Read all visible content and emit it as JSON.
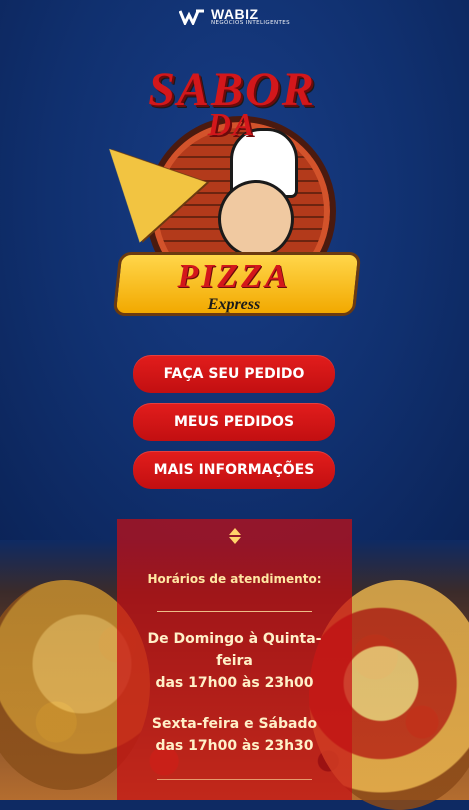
{
  "brand": {
    "name": "WABIZ",
    "tagline": "NEGÓCIOS INTELIGENTES",
    "icon": "wabiz-logo-icon"
  },
  "logo": {
    "line1": "SABOR",
    "line2": "DA",
    "ribbon_main": "PIZZA",
    "ribbon_sub": "Express"
  },
  "actions": [
    {
      "label": "FAÇA SEU PEDIDO"
    },
    {
      "label": "MEUS PEDIDOS"
    },
    {
      "label": "MAIS INFORMAÇÕES"
    }
  ],
  "hours_panel": {
    "toggle_icon": "chevron-up-down-icon",
    "title": "Horários de atendimento:",
    "line1": "De Domingo à Quinta-",
    "line2": "feira",
    "line3": "das 17h00 às 23h00",
    "line4": "Sexta-feira e Sábado",
    "line5": "das 17h00 às 23h30"
  },
  "colors": {
    "background": "#10306f",
    "button": "#d6161a",
    "panel": "#c60e14",
    "panel_text": "#ffe7a3"
  }
}
